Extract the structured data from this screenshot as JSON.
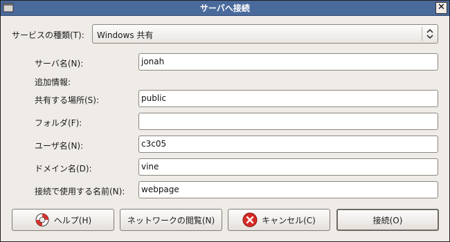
{
  "window": {
    "title": "サーバへ接続",
    "close_glyph": "✕"
  },
  "service_type": {
    "label": "サービスの種類(T):",
    "value": "Windows 共有"
  },
  "fields": {
    "server_label": "サーバ名(N):",
    "server_value": "jonah",
    "additional_info_label": "追加情報:",
    "share_label": "共有する場所(S):",
    "share_value": "public",
    "folder_label": "フォルダ(F):",
    "folder_value": "",
    "user_label": "ユーザ名(N):",
    "user_value": "c3c05",
    "domain_label": "ドメイン名(D):",
    "domain_value": "vine",
    "connection_name_label": "接続で使用する名前(N):",
    "connection_name_value": "webpage"
  },
  "buttons": {
    "help": "ヘルプ(H)",
    "browse": "ネットワークの閲覧(N)",
    "cancel": "キャンセル(C)",
    "connect": "接続(O)"
  },
  "icons": {
    "window": "window-icon",
    "help": "lifebuoy-icon",
    "cancel": "cancel-icon",
    "combo": "updown-arrows-icon"
  },
  "colors": {
    "titlebar": "#4a6a9c",
    "dialog_bg": "#efebe7",
    "help_icon_red": "#d8322e",
    "cancel_icon_red": "#d42a25"
  }
}
